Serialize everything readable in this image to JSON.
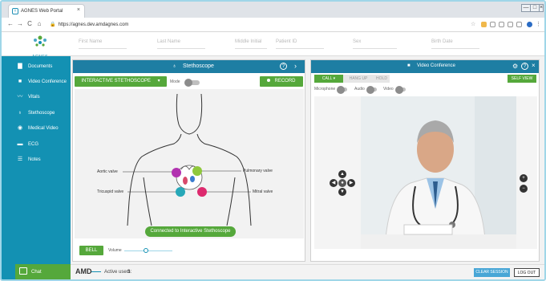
{
  "browser": {
    "tab_title": "AGNES Web Portal",
    "tab_close": "×",
    "url": "https://agnes.dev.amdagnes.com",
    "window_controls": [
      "—",
      "□",
      "×"
    ],
    "nav": {
      "back": "←",
      "forward": "→",
      "reload": "C",
      "home": "⌂"
    }
  },
  "header": {
    "logo_text": "AGNES",
    "fields": [
      {
        "placeholder": "First Name"
      },
      {
        "placeholder": "Last Name"
      },
      {
        "placeholder": "Middle Initial"
      },
      {
        "placeholder": "Patient ID"
      },
      {
        "placeholder": "Sex"
      },
      {
        "placeholder": "Birth Date"
      }
    ]
  },
  "sidebar": {
    "items": [
      {
        "label": "Documents",
        "icon": "folder-icon",
        "glyph": "▇"
      },
      {
        "label": "Video Conference",
        "icon": "video-icon",
        "glyph": "■"
      },
      {
        "label": "Vitals",
        "icon": "vitals-icon",
        "glyph": "〰"
      },
      {
        "label": "Stethoscope",
        "icon": "stethoscope-icon",
        "glyph": "♁"
      },
      {
        "label": "Medical Video",
        "icon": "camera-icon",
        "glyph": "◉"
      },
      {
        "label": "ECG",
        "icon": "ecg-icon",
        "glyph": "▬"
      },
      {
        "label": "Notes",
        "icon": "notes-icon",
        "glyph": "☰"
      }
    ],
    "chat_label": "Chat"
  },
  "stethoscope": {
    "title": "Stethoscope",
    "mode_button": "INTERACTIVE STETHOSCOPE",
    "mode_label": "Mode",
    "record_button": "RECORD",
    "valves": {
      "aortic": "Aortic valve",
      "pulmonary": "Pulmonary valve",
      "tricuspid": "Tricuspid valve",
      "mitral": "Mitral valve"
    },
    "status": "Connected to Interactive Stethoscope",
    "bell_button": "BELL",
    "volume_label": "Volume",
    "volume_level": 0.45,
    "valve_colors": {
      "aortic": "#b233b0",
      "pulmonary": "#8fc83c",
      "tricuspid": "#27a8b8",
      "mitral": "#dd2a6e"
    }
  },
  "video": {
    "title": "Video Conference",
    "call_button": "CALL",
    "hangup_button": "HANG UP",
    "hold_button": "HOLD",
    "self_view_button": "SELF VIEW",
    "toggles": {
      "microphone": "Microphone",
      "audio": "Audio",
      "video": "Video"
    }
  },
  "bottom": {
    "brand": "AMD",
    "active_users_label": "Active users:",
    "active_users_count": "3",
    "clear_session": "CLEAR SESSION",
    "logout": "LOG OUT"
  },
  "colors": {
    "primary": "#1391b3",
    "panel_header": "#1e7ea3",
    "green": "#55a83b"
  }
}
